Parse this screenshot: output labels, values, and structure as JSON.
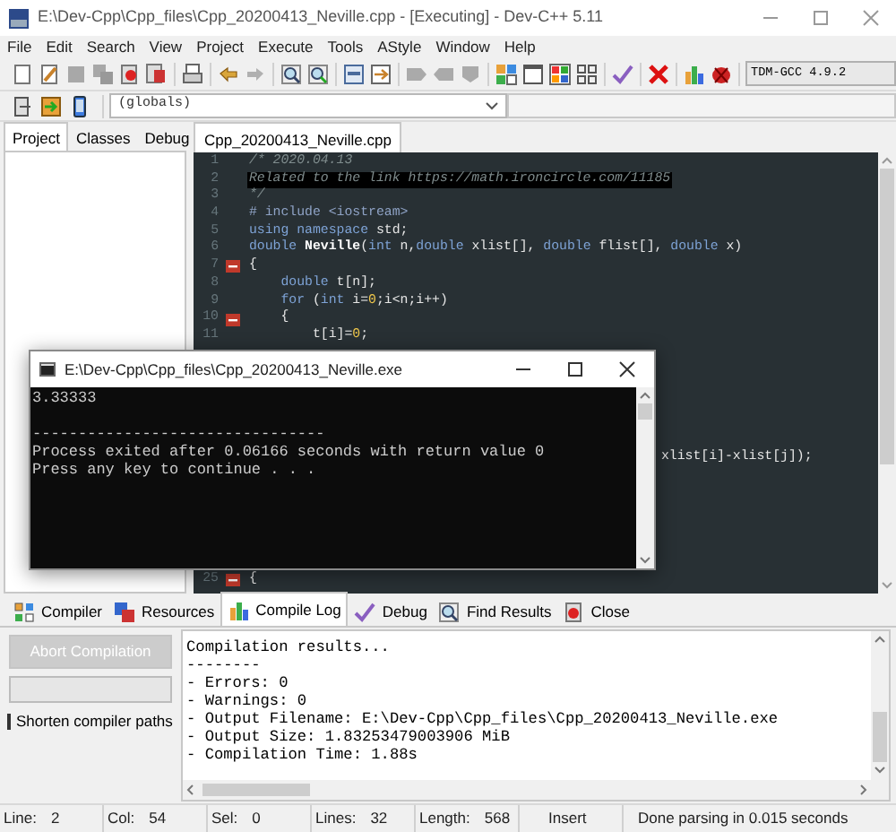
{
  "window": {
    "title": "E:\\Dev-Cpp\\Cpp_files\\Cpp_20200413_Neville.cpp - [Executing] - Dev-C++ 5.11"
  },
  "menu": [
    "File",
    "Edit",
    "Search",
    "View",
    "Project",
    "Execute",
    "Tools",
    "AStyle",
    "Window",
    "Help"
  ],
  "toolbar": {
    "compiler_select": "TDM-GCC 4.9.2",
    "scope_select": "(globals)"
  },
  "left_panel": {
    "tabs": [
      {
        "label": "Project",
        "selected": true
      },
      {
        "label": "Classes",
        "selected": false
      },
      {
        "label": "Debug",
        "selected": false
      }
    ]
  },
  "editor": {
    "tabs": [
      {
        "label": "Cpp_20200413_Neville.cpp",
        "selected": true
      }
    ],
    "lines": [
      {
        "kind": "line",
        "number": "1",
        "current": false,
        "fold": false,
        "tokens": [
          {
            "kind": "comment",
            "text": "/* 2020.04.13"
          }
        ]
      },
      {
        "kind": "line",
        "number": "2",
        "current": true,
        "fold": false,
        "tokens": [
          {
            "kind": "comment",
            "text": "Related to the link https://math.ironcircle.com/11185"
          }
        ]
      },
      {
        "kind": "line",
        "number": "3",
        "current": false,
        "fold": false,
        "tokens": [
          {
            "kind": "comment",
            "text": "*/"
          }
        ]
      },
      {
        "kind": "line",
        "number": "4",
        "current": false,
        "fold": false,
        "tokens": [
          {
            "kind": "preproc",
            "text": "# include <iostream>"
          }
        ]
      },
      {
        "kind": "line",
        "number": "5",
        "current": false,
        "fold": false,
        "tokens": [
          {
            "kind": "keyword",
            "text": "using"
          },
          {
            "kind": "keyword",
            "text": " namespace"
          },
          {
            "kind": "plain",
            "text": " std;"
          }
        ]
      },
      {
        "kind": "line",
        "number": "6",
        "current": false,
        "fold": false,
        "tokens": [
          {
            "kind": "keyword",
            "text": "double"
          },
          {
            "kind": "bold",
            "text": " Neville"
          },
          {
            "kind": "plain",
            "text": "("
          },
          {
            "kind": "keyword",
            "text": "int"
          },
          {
            "kind": "plain",
            "text": " n,"
          },
          {
            "kind": "keyword",
            "text": "double"
          },
          {
            "kind": "plain",
            "text": " xlist[], "
          },
          {
            "kind": "keyword",
            "text": "double"
          },
          {
            "kind": "plain",
            "text": " flist[], "
          },
          {
            "kind": "keyword",
            "text": "double"
          },
          {
            "kind": "plain",
            "text": " x)"
          }
        ]
      },
      {
        "kind": "line",
        "number": "7",
        "current": false,
        "fold": true,
        "tokens": [
          {
            "kind": "plain",
            "text": "{"
          }
        ]
      },
      {
        "kind": "line",
        "number": "8",
        "current": false,
        "fold": false,
        "tokens": [
          {
            "kind": "keyword",
            "text": "    double"
          },
          {
            "kind": "plain",
            "text": " t[n];"
          }
        ]
      },
      {
        "kind": "line",
        "number": "9",
        "current": false,
        "fold": false,
        "tokens": [
          {
            "kind": "keyword",
            "text": "    for"
          },
          {
            "kind": "plain",
            "text": " ("
          },
          {
            "kind": "keyword",
            "text": "int"
          },
          {
            "kind": "plain",
            "text": " i="
          },
          {
            "kind": "number",
            "text": "0"
          },
          {
            "kind": "plain",
            "text": ";i<n;i++)"
          }
        ]
      },
      {
        "kind": "line",
        "number": "10",
        "current": false,
        "fold": true,
        "tokens": [
          {
            "kind": "plain",
            "text": "    {"
          }
        ]
      },
      {
        "kind": "line",
        "number": "11",
        "current": false,
        "fold": false,
        "tokens": [
          {
            "kind": "plain",
            "text": "        t[i]="
          },
          {
            "kind": "number",
            "text": "0"
          },
          {
            "kind": "plain",
            "text": ";"
          }
        ]
      },
      {
        "kind": "covered"
      },
      {
        "kind": "covered"
      },
      {
        "kind": "covered"
      },
      {
        "kind": "covered"
      },
      {
        "kind": "covered"
      },
      {
        "kind": "covered"
      },
      {
        "kind": "tail",
        "tokens": [
          {
            "kind": "plain",
            "text": "xlist[i]-xlist[j]);"
          }
        ]
      },
      {
        "kind": "covered"
      },
      {
        "kind": "covered"
      },
      {
        "kind": "covered"
      },
      {
        "kind": "covered"
      },
      {
        "kind": "covered"
      },
      {
        "kind": "covered"
      },
      {
        "kind": "line",
        "number": "25",
        "current": false,
        "fold": true,
        "tokens": [
          {
            "kind": "plain",
            "text": "{"
          }
        ]
      }
    ]
  },
  "console": {
    "title": "E:\\Dev-Cpp\\Cpp_files\\Cpp_20200413_Neville.exe",
    "output": "3.33333\n\n--------------------------------\nProcess exited after 0.06166 seconds with return value 0\nPress any key to continue . . ."
  },
  "bottom_panel": {
    "tabs": [
      {
        "label": "Compiler",
        "selected": false
      },
      {
        "label": "Resources",
        "selected": false
      },
      {
        "label": "Compile Log",
        "selected": true
      },
      {
        "label": "Debug",
        "selected": false
      },
      {
        "label": "Find Results",
        "selected": false
      },
      {
        "label": "Close",
        "selected": false
      }
    ],
    "abort_button": {
      "label": "Abort Compilation",
      "disabled": true
    },
    "progress": {
      "level": 0
    },
    "shorten_paths": {
      "label": "Shorten compiler paths",
      "checked": false
    },
    "log": [
      "Compilation results...",
      "--------",
      "- Errors: 0",
      "- Warnings: 0",
      "- Output Filename: E:\\Dev-Cpp\\Cpp_files\\Cpp_20200413_Neville.exe",
      "- Output Size: 1.83253479003906 MiB",
      "- Compilation Time: 1.88s"
    ]
  },
  "status_bar": {
    "fields": [
      {
        "label": "Line:",
        "value": "2"
      },
      {
        "label": "Col:",
        "value": "54"
      },
      {
        "label": "Sel:",
        "value": "0"
      },
      {
        "label": "Lines:",
        "value": "32"
      },
      {
        "label": "Length:",
        "value": "568"
      }
    ],
    "mode": "Insert",
    "message": "Done parsing in 0.015 seconds"
  }
}
